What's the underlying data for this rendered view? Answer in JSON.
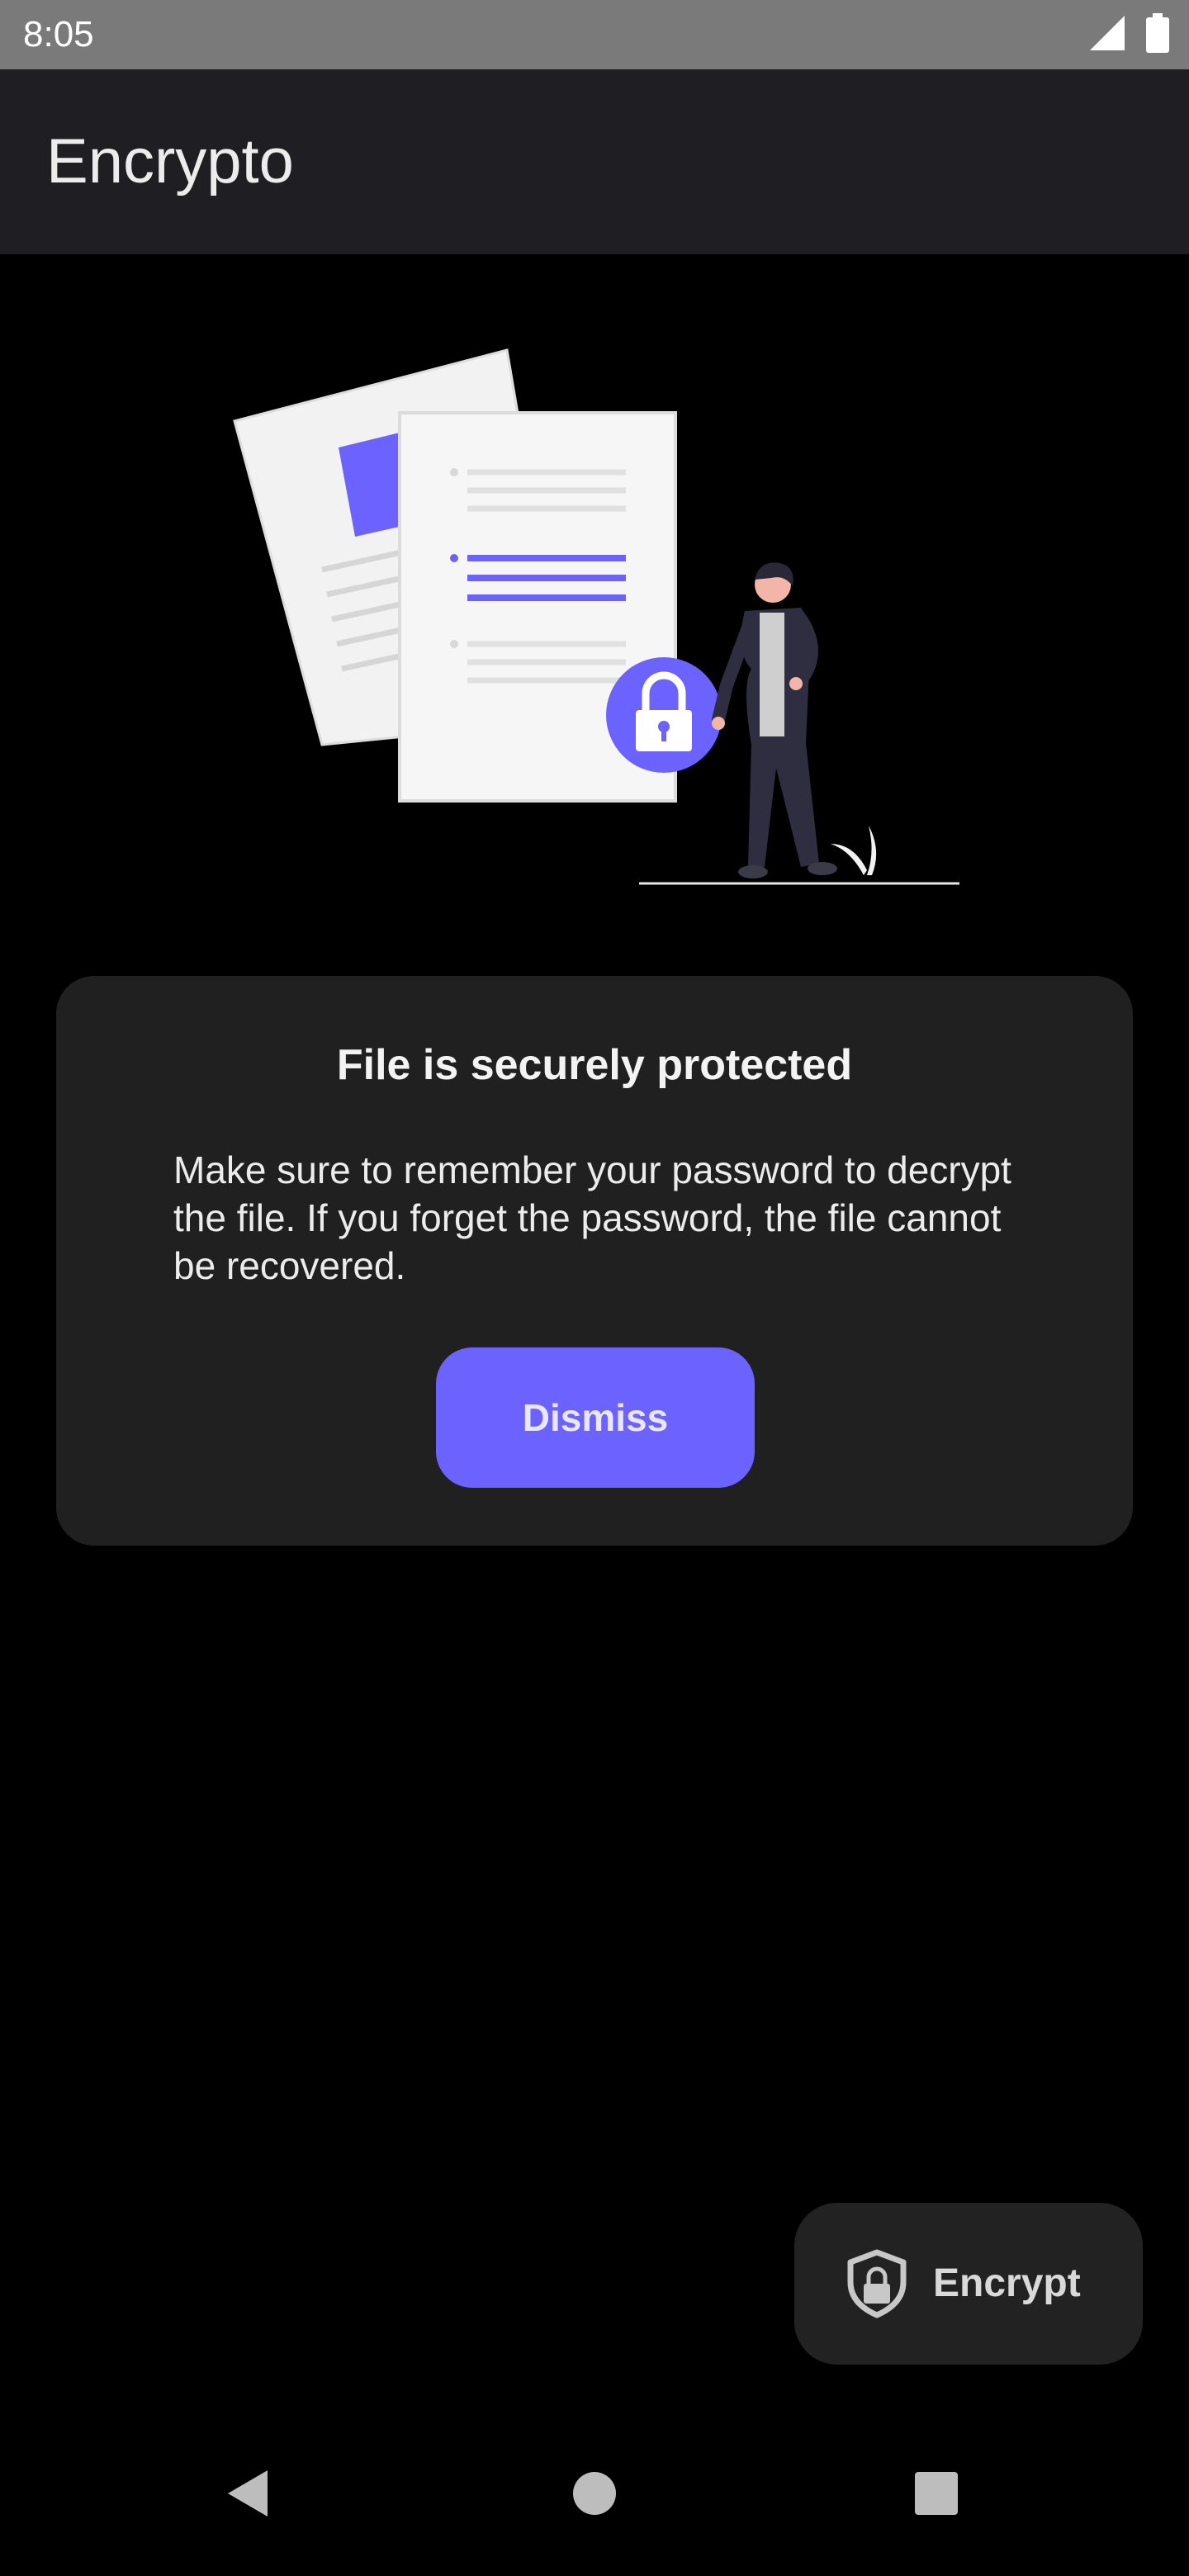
{
  "status_bar": {
    "time": "8:05",
    "icons": [
      "signal-icon",
      "battery-icon"
    ]
  },
  "app_bar": {
    "title": "Encrypto"
  },
  "illustration": {
    "name": "secure-files-illustration"
  },
  "card": {
    "title": "File is securely protected",
    "body": "Make sure to remember your password to decrypt the file. If you forget the password, the file cannot be recovered.",
    "dismiss_label": "Dismiss"
  },
  "fab": {
    "label": "Encrypt",
    "icon": "shield-lock-icon"
  },
  "nav": {
    "back": "back-icon",
    "home": "home-icon",
    "recents": "recents-icon"
  },
  "colors": {
    "accent": "#6c63ff",
    "background": "#000000",
    "app_bar": "#1f1f23",
    "card": "#202020",
    "status_bar": "#7a7a7a"
  }
}
